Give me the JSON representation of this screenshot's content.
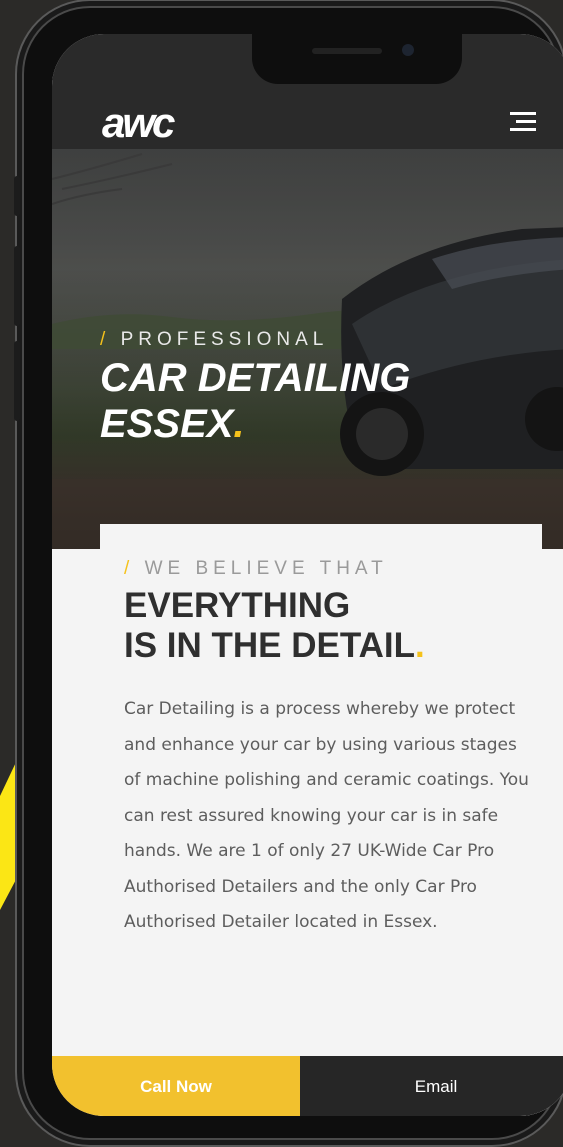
{
  "header": {
    "logo_text": "awc",
    "menu_icon": "hamburger-menu-icon"
  },
  "hero": {
    "kicker_slash": "/",
    "kicker": "PROFESSIONAL",
    "title_line1": "CAR DETAILING",
    "title_line2": "ESSEX",
    "title_dot": "."
  },
  "card": {
    "kicker_slash": "/",
    "kicker": "WE BELIEVE THAT",
    "title_line1": "EVERYTHING",
    "title_line2": "IS IN THE DETAIL",
    "title_dot": ".",
    "body": "Car Detailing is a process whereby we protect and enhance your car by using various stages of machine polishing and ceramic coatings. You can rest assured knowing your car is in safe hands. We are 1 of only 27 UK-Wide Car Pro Authorised Detailers and the only Car Pro Authorised Detailer located in Essex."
  },
  "cta": {
    "call_label": "Call Now",
    "email_label": "Email"
  },
  "colors": {
    "accent": "#f2c12e",
    "decor_yellow": "#fbe615",
    "dark": "#2a2a2a",
    "page_bg": "#2b2a28"
  }
}
